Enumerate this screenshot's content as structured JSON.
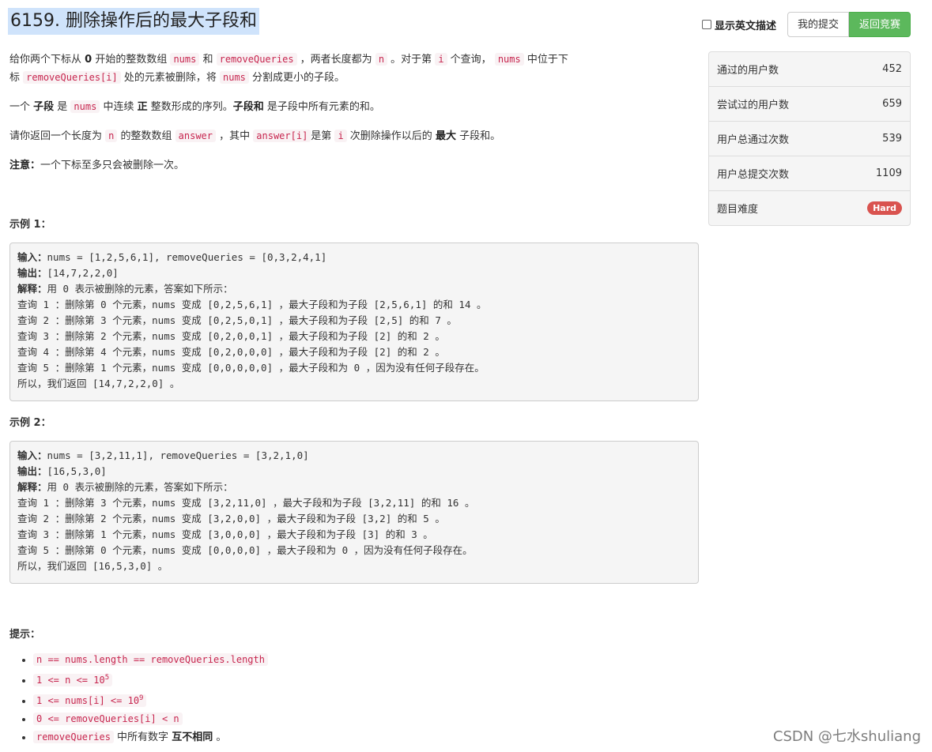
{
  "problem": {
    "title": "6159. 删除操作后的最大子段和"
  },
  "controls": {
    "english_label": "显示英文描述",
    "my_submissions": "我的提交",
    "back_to_contest": "返回竞赛"
  },
  "desc": {
    "p1_a": "给你两个下标从 ",
    "p1_b": "0",
    "p1_c": " 开始的整数数组 ",
    "p1_code1": "nums",
    "p1_d": " 和 ",
    "p1_code2": "removeQueries",
    "p1_e": " ，两者长度都为 ",
    "p1_code3": "n",
    "p1_f": " 。对于第 ",
    "p1_code4": "i",
    "p1_g": " 个查询， ",
    "p1_code5": "nums",
    "p1_h": " 中位于下",
    "p1_i": "标 ",
    "p1_code6": "removeQueries[i]",
    "p1_j": " 处的元素被删除，将 ",
    "p1_code7": "nums",
    "p1_k": " 分割成更小的子段。",
    "p2_a": "一个 ",
    "p2_b": "子段",
    "p2_c": " 是 ",
    "p2_code1": "nums",
    "p2_d": " 中连续 ",
    "p2_e": "正",
    "p2_f": " 整数形成的序列。",
    "p2_g": "子段和",
    "p2_h": " 是子段中所有元素的和。",
    "p3_a": "请你返回一个长度为 ",
    "p3_code1": "n",
    "p3_b": " 的整数数组 ",
    "p3_code2": "answer",
    "p3_c": " ，其中 ",
    "p3_code3": "answer[i]",
    "p3_d": "是第 ",
    "p3_code4": "i",
    "p3_e": " 次删除操作以后的 ",
    "p3_f": "最大",
    "p3_g": " 子段和。",
    "note_label": "注意：",
    "note_text": "一个下标至多只会被删除一次。"
  },
  "example1": {
    "heading": "示例 1：",
    "input_label": "输入：",
    "input_text": "nums = [1,2,5,6,1], removeQueries = [0,3,2,4,1]",
    "output_label": "输出：",
    "output_text": "[14,7,2,2,0]",
    "explain_label": "解释：",
    "explain_text": "用 0 表示被删除的元素，答案如下所示：",
    "lines": [
      "查询 1 ：删除第 0 个元素，nums 变成 [0,2,5,6,1] ，最大子段和为子段 [2,5,6,1] 的和 14 。",
      "查询 2 ：删除第 3 个元素，nums 变成 [0,2,5,0,1] ，最大子段和为子段 [2,5] 的和 7 。",
      "查询 3 ：删除第 2 个元素，nums 变成 [0,2,0,0,1] ，最大子段和为子段 [2] 的和 2 。",
      "查询 4 ：删除第 4 个元素，nums 变成 [0,2,0,0,0] ，最大子段和为子段 [2] 的和 2 。",
      "查询 5 ：删除第 1 个元素，nums 变成 [0,0,0,0,0] ，最大子段和为 0 ，因为没有任何子段存在。",
      "所以，我们返回 [14,7,2,2,0] 。"
    ]
  },
  "example2": {
    "heading": "示例 2：",
    "input_label": "输入：",
    "input_text": "nums = [3,2,11,1], removeQueries = [3,2,1,0]",
    "output_label": "输出：",
    "output_text": "[16,5,3,0]",
    "explain_label": "解释：",
    "explain_text": "用 0 表示被删除的元素，答案如下所示：",
    "lines": [
      "查询 1 ：删除第 3 个元素，nums 变成 [3,2,11,0] ，最大子段和为子段 [3,2,11] 的和 16 。",
      "查询 2 ：删除第 2 个元素，nums 变成 [3,2,0,0] ，最大子段和为子段 [3,2] 的和 5 。",
      "查询 3 ：删除第 1 个元素，nums 变成 [3,0,0,0] ，最大子段和为子段 [3] 的和 3 。",
      "查询 5 ：删除第 0 个元素，nums 变成 [0,0,0,0] ，最大子段和为 0 ，因为没有任何子段存在。",
      "所以，我们返回 [16,5,3,0] 。"
    ]
  },
  "hints": {
    "heading": "提示：",
    "h1": "n == nums.length == removeQueries.length",
    "h2_base": "1 <= n <= 10",
    "h2_sup": "5",
    "h3_base": "1 <= nums[i] <= 10",
    "h3_sup": "9",
    "h4": "0 <= removeQueries[i] < n",
    "h5_code": "removeQueries",
    "h5_a": " 中所有数字 ",
    "h5_b": "互不相同",
    "h5_c": " 。"
  },
  "stats": {
    "rows": [
      {
        "label": "通过的用户数",
        "value": "452"
      },
      {
        "label": "尝试过的用户数",
        "value": "659"
      },
      {
        "label": "用户总通过次数",
        "value": "539"
      },
      {
        "label": "用户总提交次数",
        "value": "1109"
      }
    ],
    "difficulty_label": "题目难度",
    "difficulty_value": "Hard"
  },
  "watermark": "CSDN @七水shuliang",
  "colors": {
    "accent_green": "#5cb85c",
    "hard_red": "#d9534f",
    "code_red": "#c7254e",
    "title_highlight": "#cfe3fb"
  }
}
